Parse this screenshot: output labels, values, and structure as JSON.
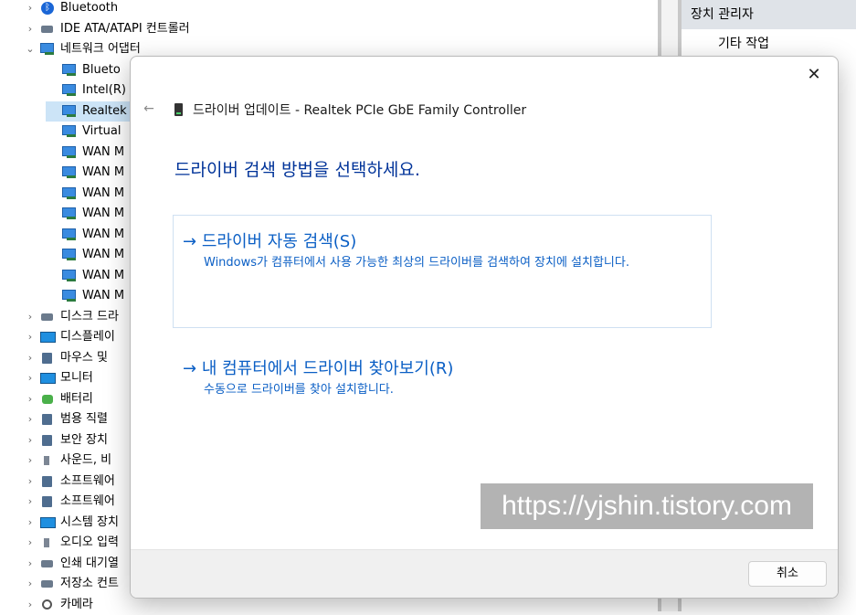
{
  "tree": {
    "rows": [
      {
        "label": "Bluetooth",
        "chev": "›",
        "icon": "bluetooth-icon",
        "indent": 0
      },
      {
        "label": "IDE ATA/ATAPI 컨트롤러",
        "chev": "›",
        "icon": "ide-controller-icon",
        "indent": 0
      },
      {
        "label": "네트워크 어댑터",
        "chev": "⌄",
        "icon": "network-adapter-icon",
        "indent": 0
      },
      {
        "label": "Blueto",
        "chev": "",
        "icon": "network-adapter-icon",
        "indent": 1
      },
      {
        "label": "Intel(R)",
        "chev": "",
        "icon": "network-adapter-icon",
        "indent": 1
      },
      {
        "label": "Realtek",
        "chev": "",
        "icon": "network-adapter-icon",
        "indent": 1,
        "selected": true
      },
      {
        "label": "Virtual",
        "chev": "",
        "icon": "network-adapter-icon",
        "indent": 1
      },
      {
        "label": "WAN M",
        "chev": "",
        "icon": "network-adapter-icon",
        "indent": 1
      },
      {
        "label": "WAN M",
        "chev": "",
        "icon": "network-adapter-icon",
        "indent": 1
      },
      {
        "label": "WAN M",
        "chev": "",
        "icon": "network-adapter-icon",
        "indent": 1
      },
      {
        "label": "WAN M",
        "chev": "",
        "icon": "network-adapter-icon",
        "indent": 1
      },
      {
        "label": "WAN M",
        "chev": "",
        "icon": "network-adapter-icon",
        "indent": 1
      },
      {
        "label": "WAN M",
        "chev": "",
        "icon": "network-adapter-icon",
        "indent": 1
      },
      {
        "label": "WAN M",
        "chev": "",
        "icon": "network-adapter-icon",
        "indent": 1
      },
      {
        "label": "WAN M",
        "chev": "",
        "icon": "network-adapter-icon",
        "indent": 1
      },
      {
        "label": "디스크 드라",
        "chev": "›",
        "icon": "disk-drive-icon",
        "indent": 0
      },
      {
        "label": "디스플레이",
        "chev": "›",
        "icon": "display-adapter-icon",
        "indent": 0
      },
      {
        "label": "마우스 및",
        "chev": "›",
        "icon": "mouse-icon",
        "indent": 0
      },
      {
        "label": "모니터",
        "chev": "›",
        "icon": "monitor-icon",
        "indent": 0
      },
      {
        "label": "배터리",
        "chev": "›",
        "icon": "battery-icon",
        "indent": 0
      },
      {
        "label": "범용 직렬",
        "chev": "›",
        "icon": "usb-icon",
        "indent": 0
      },
      {
        "label": "보안 장치",
        "chev": "›",
        "icon": "security-device-icon",
        "indent": 0
      },
      {
        "label": "사운드, 비",
        "chev": "›",
        "icon": "speaker-icon",
        "indent": 0
      },
      {
        "label": "소프트웨어",
        "chev": "›",
        "icon": "software-component-icon",
        "indent": 0
      },
      {
        "label": "소프트웨어",
        "chev": "›",
        "icon": "software-device-icon",
        "indent": 0
      },
      {
        "label": "시스템 장치",
        "chev": "›",
        "icon": "system-device-icon",
        "indent": 0
      },
      {
        "label": "오디오 입력",
        "chev": "›",
        "icon": "speaker-icon",
        "indent": 0
      },
      {
        "label": "인쇄 대기열",
        "chev": "›",
        "icon": "printer-icon",
        "indent": 0
      },
      {
        "label": "저장소 컨트",
        "chev": "›",
        "icon": "storage-controller-icon",
        "indent": 0
      },
      {
        "label": "카메라",
        "chev": "›",
        "icon": "camera-icon",
        "indent": 0
      }
    ]
  },
  "actions": {
    "header": "장치 관리자",
    "sub": "기타 작업"
  },
  "dialog": {
    "close_label": "✕",
    "back_label": "←",
    "title": "드라이버 업데이트 - Realtek PCIe GbE Family Controller",
    "heading": "드라이버 검색 방법을 선택하세요.",
    "option_auto": {
      "arrow": "→",
      "title": "드라이버 자동 검색(S)",
      "desc": "Windows가 컴퓨터에서 사용 가능한 최상의 드라이버를 검색하여 장치에 설치합니다."
    },
    "option_browse": {
      "arrow": "→",
      "title": "내 컴퓨터에서 드라이버 찾아보기(R)",
      "desc": "수동으로 드라이버를 찾아 설치합니다."
    },
    "watermark": "https://yjshin.tistory.com",
    "cancel_label": "취소"
  },
  "colors": {
    "link": "#0b5fc5",
    "heading": "#003399",
    "selected_row": "#cce4f7"
  }
}
